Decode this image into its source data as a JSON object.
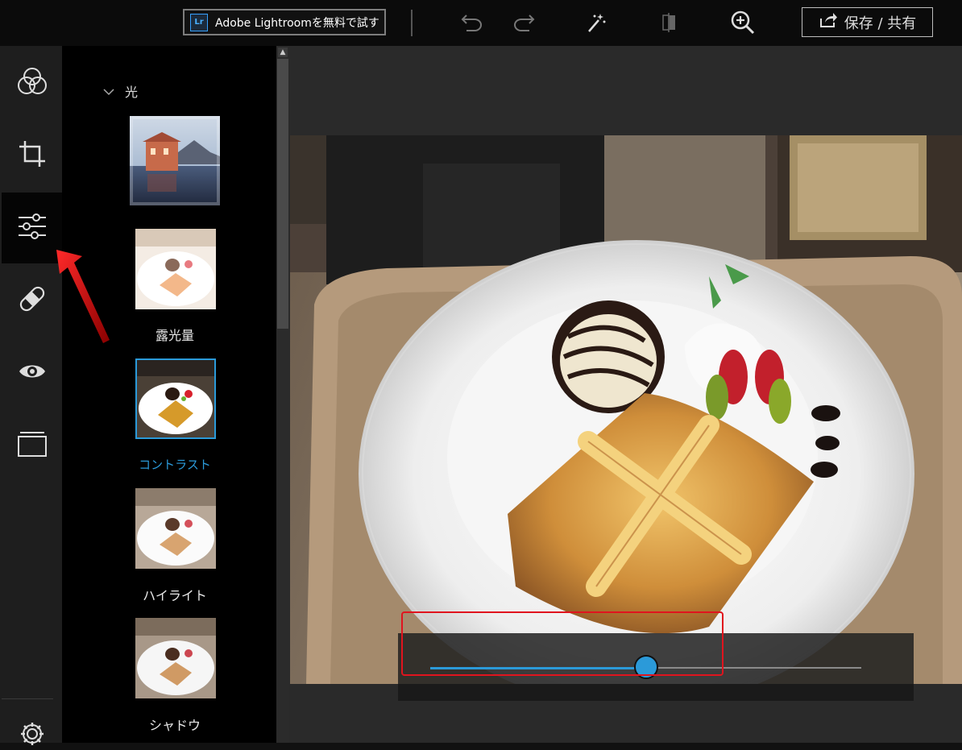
{
  "toolbar": {
    "lightroom_logo": "Lr",
    "lightroom_label": "Adobe Lightroomを無料で試す",
    "icons": [
      "undo-icon",
      "redo-icon",
      "magic-wand-icon",
      "compare-icon",
      "zoom-in-icon"
    ],
    "save_label": "保存 / 共有"
  },
  "rail": {
    "items": [
      {
        "name": "filters",
        "icon": "color-circles-icon"
      },
      {
        "name": "crop",
        "icon": "crop-icon"
      },
      {
        "name": "adjust",
        "icon": "sliders-icon",
        "active": true
      },
      {
        "name": "healing",
        "icon": "bandage-icon"
      },
      {
        "name": "red-eye",
        "icon": "eye-icon"
      },
      {
        "name": "frames",
        "icon": "frame-icon"
      }
    ],
    "settings_icon": "gear-icon"
  },
  "panel": {
    "section_title": "光",
    "items": [
      {
        "label": "露光量"
      },
      {
        "label": "コントラスト",
        "selected": true
      },
      {
        "label": "ハイライト"
      },
      {
        "label": "シャドウ"
      }
    ]
  },
  "slider": {
    "value_fraction": 0.5
  },
  "colors": {
    "accent": "#2b9ad9",
    "annotation_red": "#e0141e",
    "toolbar_bg": "#0b0b0b",
    "rail_bg": "#1e1e1e",
    "canvas_bg": "#2a2a2a"
  }
}
